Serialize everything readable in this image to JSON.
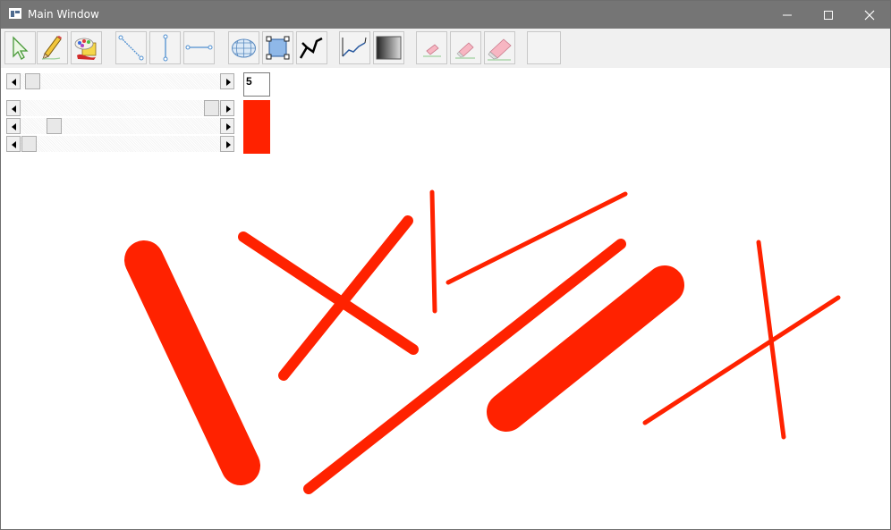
{
  "window": {
    "title": "Main Window"
  },
  "toolbar": {
    "tools": [
      {
        "name": "select-tool",
        "icon": "arrow-cursor-icon"
      },
      {
        "name": "pencil-tool",
        "icon": "pencil-icon"
      },
      {
        "name": "palette-tool",
        "icon": "paint-palette-icon"
      },
      {
        "name": "diagonal-line-tool",
        "icon": "diagonal-line-icon"
      },
      {
        "name": "vertical-line-tool",
        "icon": "vertical-line-icon"
      },
      {
        "name": "horizontal-line-tool",
        "icon": "horizontal-line-icon"
      },
      {
        "name": "grid-fill-tool",
        "icon": "grid-sphere-icon"
      },
      {
        "name": "resize-tool",
        "icon": "resize-handles-icon"
      },
      {
        "name": "polyline-tool",
        "icon": "polyline-icon"
      },
      {
        "name": "curve-tool",
        "icon": "curve-icon"
      },
      {
        "name": "gradient-tool",
        "icon": "gradient-icon"
      },
      {
        "name": "small-eraser-tool",
        "icon": "small-eraser-icon"
      },
      {
        "name": "medium-eraser-tool",
        "icon": "medium-eraser-icon"
      },
      {
        "name": "large-eraser-tool",
        "icon": "large-eraser-icon"
      },
      {
        "name": "blank-tool",
        "icon": "blank-icon"
      }
    ]
  },
  "controls": {
    "brush_size": "5",
    "brush_size_level": 0.03,
    "color_sliders": {
      "red": 0.97,
      "green": 0.08,
      "blue": 0.03
    },
    "current_color": "#ff2200"
  },
  "drawing": {
    "stroke_color": "#ff2200"
  }
}
